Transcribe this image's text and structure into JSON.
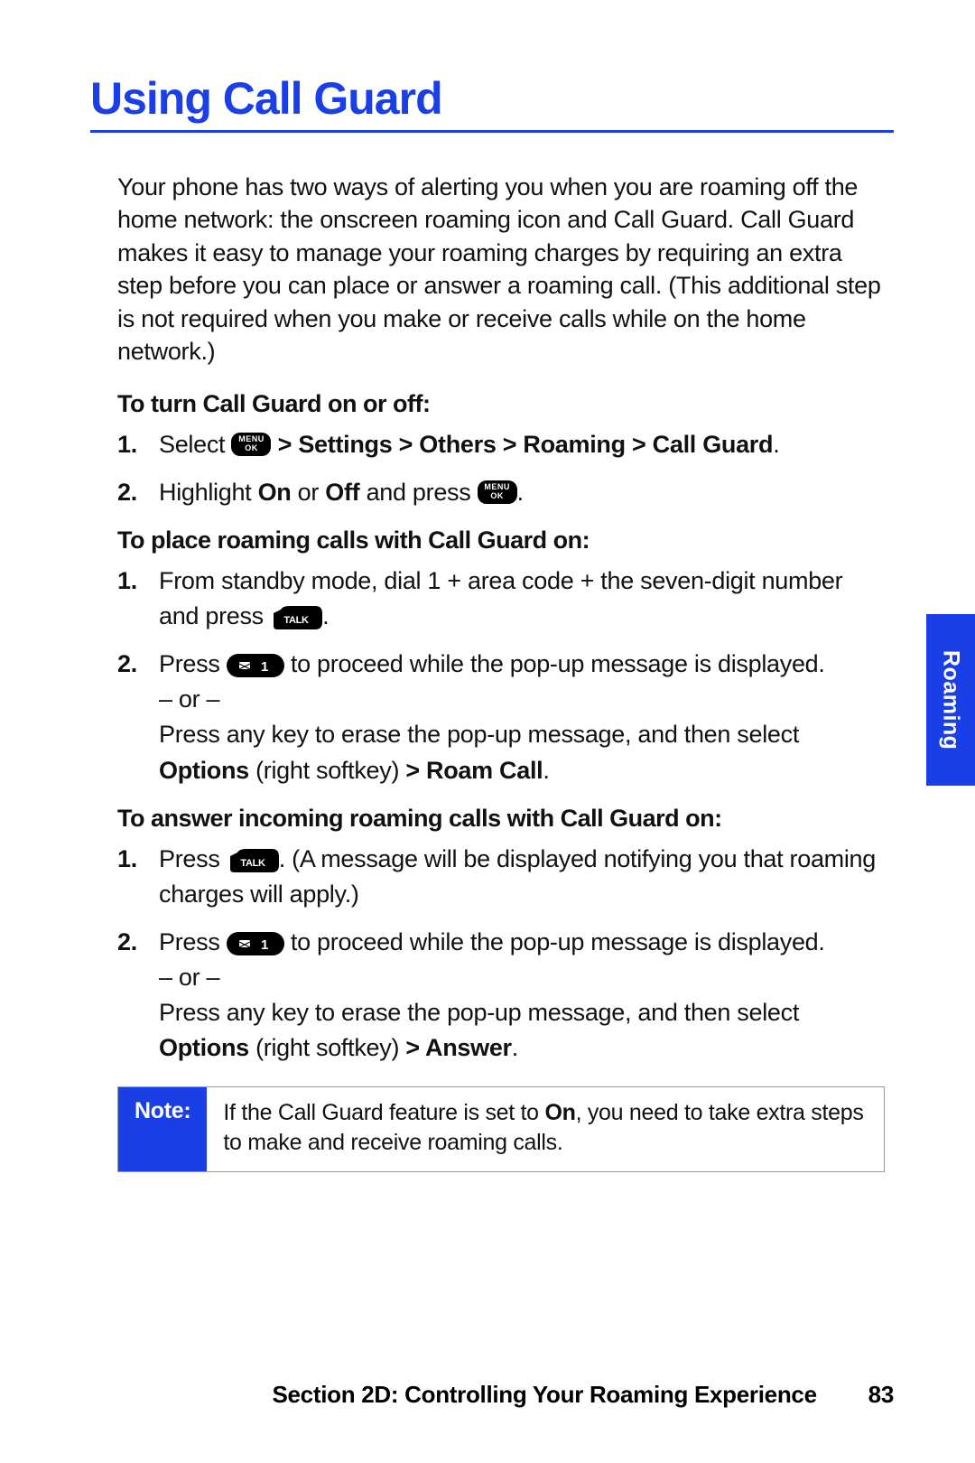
{
  "title": "Using Call Guard",
  "intro": "Your phone has two ways of alerting you when you are roaming off the home network: the onscreen roaming icon and Call Guard. Call Guard makes it easy to manage your roaming charges by requiring an extra step before you can place or answer a roaming call. (This additional step is not required when you make or receive calls while on the home network.)",
  "sections": {
    "turn_on_off": {
      "heading": "To turn Call Guard on or off:",
      "steps": [
        {
          "num": "1.",
          "pre": "Select ",
          "key": "menu",
          "post_bold": " > Settings > Others > Roaming > Call Guard",
          "tail": "."
        },
        {
          "num": "2.",
          "pre": "Highlight ",
          "b1": "On",
          "mid": " or ",
          "b2": "Off",
          "post": " and press ",
          "key": "menu",
          "tail": "."
        }
      ]
    },
    "place_roaming": {
      "heading": "To place roaming calls with Call Guard on:",
      "steps": [
        {
          "num": "1.",
          "text_pre": "From standby mode, dial 1 + area code + the seven-digit number and press ",
          "key": "talk",
          "tail": "."
        },
        {
          "num": "2.",
          "text_pre": "Press ",
          "key": "one",
          "text_mid": " to proceed while the pop-up message is displayed.",
          "or": " – or – ",
          "alt_pre": "Press any key to erase the pop-up message, and then select ",
          "alt_b1": "Options",
          "alt_mid": " (right softkey) ",
          "alt_b2": "> Roam Call",
          "tail2": "."
        }
      ]
    },
    "answer_roaming": {
      "heading": "To answer incoming roaming calls with Call Guard on:",
      "steps": [
        {
          "num": "1.",
          "text_pre": "Press ",
          "key": "talk",
          "text_post": ". (A message will be displayed notifying you that roaming charges will apply.)"
        },
        {
          "num": "2.",
          "text_pre": "Press ",
          "key": "one",
          "text_mid": " to proceed while the pop-up message is displayed.",
          "or": " – or – ",
          "alt_pre": "Press any key to erase the pop-up message, and then select ",
          "alt_b1": "Options",
          "alt_mid": " (right softkey) ",
          "alt_b2": "> Answer",
          "tail2": "."
        }
      ]
    }
  },
  "note": {
    "label": "Note:",
    "pre": "If the Call Guard feature is set to ",
    "b": "On",
    "post": ", you need to take extra steps to make and receive roaming calls."
  },
  "side_tab": "Roaming",
  "footer": {
    "section": "Section 2D: Controlling Your Roaming Experience",
    "page": "83"
  },
  "keys": {
    "menu_top": "MENU",
    "menu_bottom": "OK",
    "talk": "TALK",
    "one": "1"
  }
}
